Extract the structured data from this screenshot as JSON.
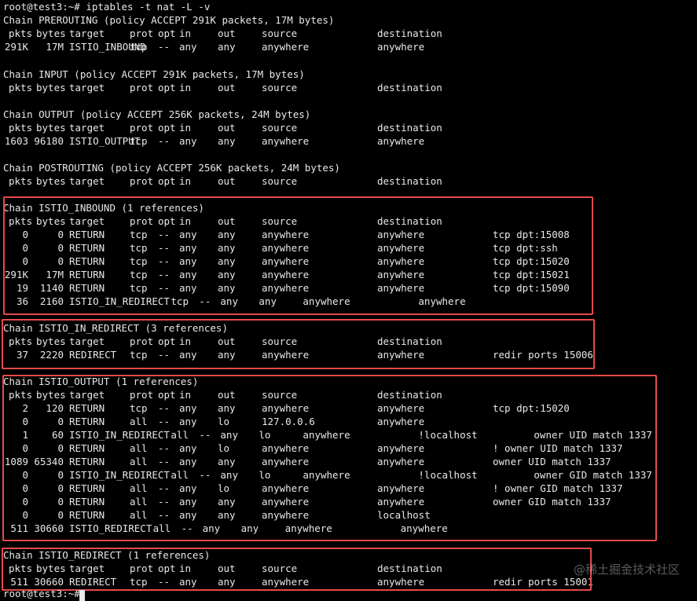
{
  "terminal": {
    "prompt_command": "root@test3:~# iptables -t nat -L -v",
    "last_prompt": "root@test3:~#",
    "watermark": "@稀土掘金技术社区"
  },
  "header_row": [
    "pkts",
    "bytes",
    "target",
    "prot",
    "opt",
    "in",
    "out",
    "source",
    "destination"
  ],
  "chains": [
    {
      "title": "Chain PREROUTING (policy ACCEPT 291K packets, 17M bytes)",
      "rows": [
        {
          "pkts": "291K",
          "bytes": "17M",
          "target": "ISTIO_INBOUND",
          "prot": "tcp",
          "opt": "--",
          "in": "any",
          "out": "any",
          "source": "anywhere",
          "destination": "anywhere",
          "extra": ""
        }
      ]
    },
    {
      "title": "Chain INPUT (policy ACCEPT 291K packets, 17M bytes)",
      "rows": []
    },
    {
      "title": "Chain OUTPUT (policy ACCEPT 256K packets, 24M bytes)",
      "rows": [
        {
          "pkts": "1603",
          "bytes": "96180",
          "target": "ISTIO_OUTPUT",
          "prot": "tcp",
          "opt": "--",
          "in": "any",
          "out": "any",
          "source": "anywhere",
          "destination": "anywhere",
          "extra": ""
        }
      ]
    },
    {
      "title": "Chain POSTROUTING (policy ACCEPT 256K packets, 24M bytes)",
      "rows": []
    },
    {
      "title": "Chain ISTIO_INBOUND (1 references)",
      "rows": [
        {
          "pkts": "0",
          "bytes": "0",
          "target": "RETURN",
          "prot": "tcp",
          "opt": "--",
          "in": "any",
          "out": "any",
          "source": "anywhere",
          "destination": "anywhere",
          "extra": "tcp dpt:15008"
        },
        {
          "pkts": "0",
          "bytes": "0",
          "target": "RETURN",
          "prot": "tcp",
          "opt": "--",
          "in": "any",
          "out": "any",
          "source": "anywhere",
          "destination": "anywhere",
          "extra": "tcp dpt:ssh"
        },
        {
          "pkts": "0",
          "bytes": "0",
          "target": "RETURN",
          "prot": "tcp",
          "opt": "--",
          "in": "any",
          "out": "any",
          "source": "anywhere",
          "destination": "anywhere",
          "extra": "tcp dpt:15020"
        },
        {
          "pkts": "291K",
          "bytes": "17M",
          "target": "RETURN",
          "prot": "tcp",
          "opt": "--",
          "in": "any",
          "out": "any",
          "source": "anywhere",
          "destination": "anywhere",
          "extra": "tcp dpt:15021"
        },
        {
          "pkts": "19",
          "bytes": "1140",
          "target": "RETURN",
          "prot": "tcp",
          "opt": "--",
          "in": "any",
          "out": "any",
          "source": "anywhere",
          "destination": "anywhere",
          "extra": "tcp dpt:15090"
        },
        {
          "pkts": "36",
          "bytes": "2160",
          "target": "ISTIO_IN_REDIRECT",
          "prot": "tcp",
          "opt": "--",
          "in": "any",
          "out": "any",
          "source": "anywhere",
          "destination": "anywhere",
          "extra": ""
        }
      ]
    },
    {
      "title": "Chain ISTIO_IN_REDIRECT (3 references)",
      "rows": [
        {
          "pkts": "37",
          "bytes": "2220",
          "target": "REDIRECT",
          "prot": "tcp",
          "opt": "--",
          "in": "any",
          "out": "any",
          "source": "anywhere",
          "destination": "anywhere",
          "extra": "redir ports 15006"
        }
      ]
    },
    {
      "title": "Chain ISTIO_OUTPUT (1 references)",
      "rows": [
        {
          "pkts": "2",
          "bytes": "120",
          "target": "RETURN",
          "prot": "tcp",
          "opt": "--",
          "in": "any",
          "out": "any",
          "source": "anywhere",
          "destination": "anywhere",
          "extra": "tcp dpt:15020"
        },
        {
          "pkts": "0",
          "bytes": "0",
          "target": "RETURN",
          "prot": "all",
          "opt": "--",
          "in": "any",
          "out": "lo",
          "source": "127.0.0.6",
          "destination": "anywhere",
          "extra": ""
        },
        {
          "pkts": "1",
          "bytes": "60",
          "target": "ISTIO_IN_REDIRECT",
          "prot": "all",
          "opt": "--",
          "in": "any",
          "out": "lo",
          "source": "anywhere",
          "destination": "!localhost",
          "extra": "owner UID match 1337"
        },
        {
          "pkts": "0",
          "bytes": "0",
          "target": "RETURN",
          "prot": "all",
          "opt": "--",
          "in": "any",
          "out": "lo",
          "source": "anywhere",
          "destination": "anywhere",
          "extra": "! owner UID match 1337"
        },
        {
          "pkts": "1089",
          "bytes": "65340",
          "target": "RETURN",
          "prot": "all",
          "opt": "--",
          "in": "any",
          "out": "any",
          "source": "anywhere",
          "destination": "anywhere",
          "extra": "owner UID match 1337"
        },
        {
          "pkts": "0",
          "bytes": "0",
          "target": "ISTIO_IN_REDIRECT",
          "prot": "all",
          "opt": "--",
          "in": "any",
          "out": "lo",
          "source": "anywhere",
          "destination": "!localhost",
          "extra": "owner GID match 1337"
        },
        {
          "pkts": "0",
          "bytes": "0",
          "target": "RETURN",
          "prot": "all",
          "opt": "--",
          "in": "any",
          "out": "lo",
          "source": "anywhere",
          "destination": "anywhere",
          "extra": "! owner GID match 1337"
        },
        {
          "pkts": "0",
          "bytes": "0",
          "target": "RETURN",
          "prot": "all",
          "opt": "--",
          "in": "any",
          "out": "any",
          "source": "anywhere",
          "destination": "anywhere",
          "extra": "owner GID match 1337"
        },
        {
          "pkts": "0",
          "bytes": "0",
          "target": "RETURN",
          "prot": "all",
          "opt": "--",
          "in": "any",
          "out": "any",
          "source": "anywhere",
          "destination": "localhost",
          "extra": ""
        },
        {
          "pkts": "511",
          "bytes": "30660",
          "target": "ISTIO_REDIRECT",
          "prot": "all",
          "opt": "--",
          "in": "any",
          "out": "any",
          "source": "anywhere",
          "destination": "anywhere",
          "extra": ""
        }
      ]
    },
    {
      "title": "Chain ISTIO_REDIRECT (1 references)",
      "rows": [
        {
          "pkts": "511",
          "bytes": "30660",
          "target": "REDIRECT",
          "prot": "tcp",
          "opt": "--",
          "in": "any",
          "out": "any",
          "source": "anywhere",
          "destination": "anywhere",
          "extra": "redir ports 15001"
        }
      ]
    }
  ],
  "highlight_color": "#e64a4a"
}
